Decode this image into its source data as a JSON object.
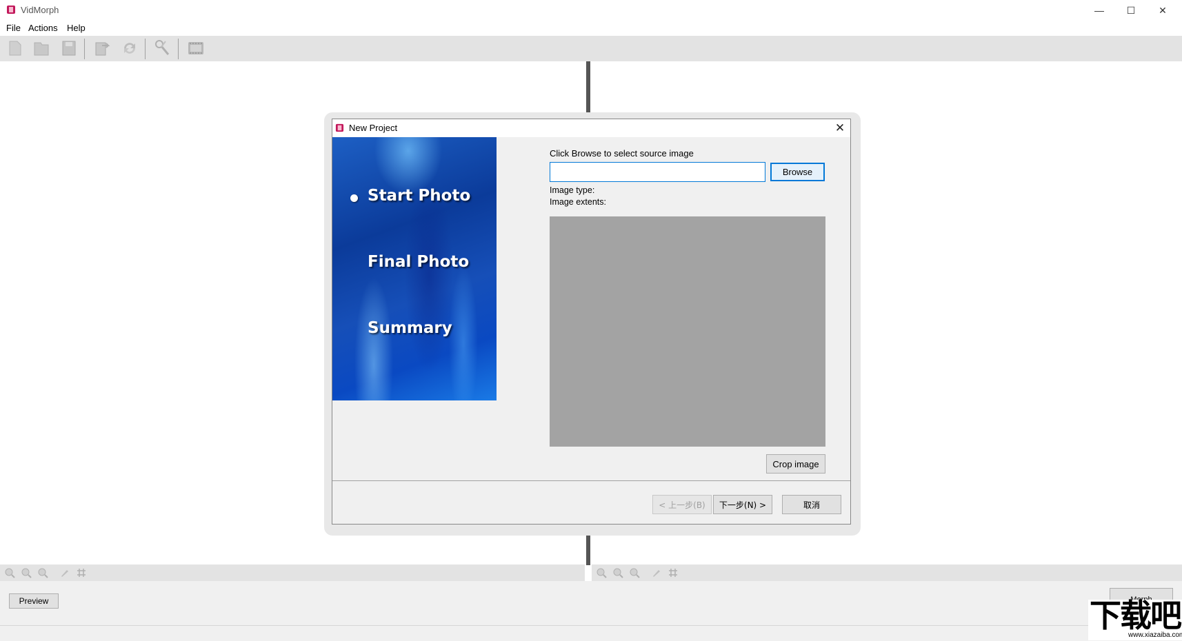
{
  "app": {
    "title": "VidMorph",
    "window_controls": {
      "minimize": "—",
      "maximize": "☐",
      "close": "✕"
    }
  },
  "menu": {
    "items": [
      "File",
      "Actions",
      "Help"
    ]
  },
  "toolbar": {
    "icons": [
      "new-icon",
      "open-icon",
      "save-icon",
      "export-icon",
      "refresh-icon",
      "tools-icon",
      "film-icon"
    ]
  },
  "workspace": {
    "preview_label": "Preview",
    "morph_label": "Morph"
  },
  "dialog": {
    "title": "New Project",
    "close": "✕",
    "steps": [
      "Start Photo",
      "Final Photo",
      "Summary"
    ],
    "active_step": "Start Photo",
    "prompt": "Click Browse to select source image",
    "source_value": "",
    "browse_label": "Browse",
    "image_type_label": "Image type:",
    "image_extents_label": "Image extents:",
    "crop_label": "Crop image",
    "back_label": "< 上一步(B)",
    "next_label": "下一步(N) >",
    "cancel_label": "取消"
  },
  "watermark": {
    "text": "下载吧",
    "url": "www.xiazaiba.com"
  },
  "colors": {
    "accent": "#0078d7",
    "toolbar_bg": "#e3e3e3",
    "preview_bg": "#a3a3a3",
    "wizard_blue": "#0b3b9a"
  }
}
